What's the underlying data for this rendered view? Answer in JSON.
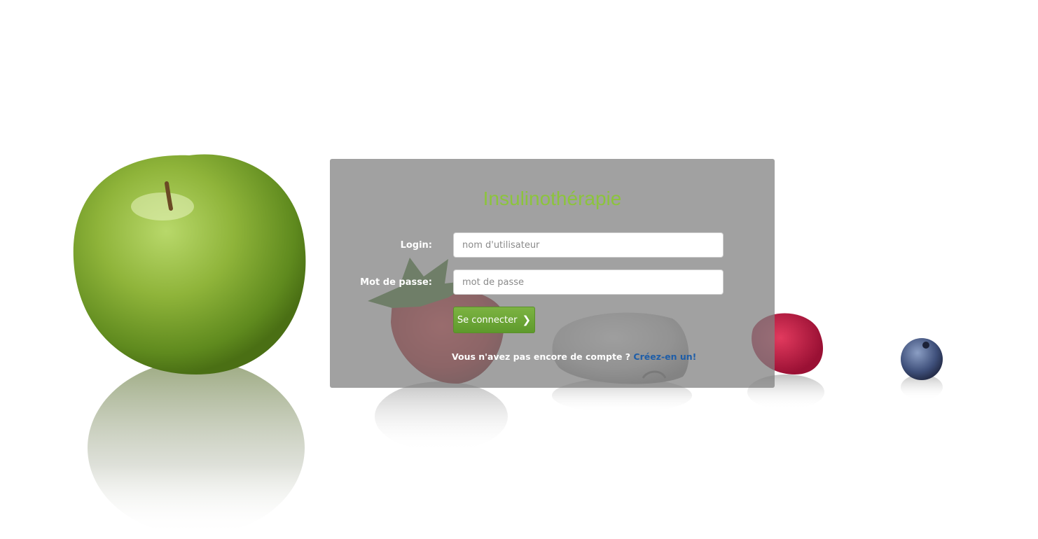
{
  "app": {
    "title": "Insulinothérapie",
    "accent_color": "#8cc43c"
  },
  "form": {
    "login_label": "Login:",
    "login_placeholder": "nom d'utilisateur",
    "login_value": "",
    "password_label": "Mot de passe:",
    "password_placeholder": "mot de passe",
    "password_value": "",
    "submit_label": "Se connecter",
    "submit_icon": "chevron-right-icon"
  },
  "signup": {
    "prompt": "Vous n'avez pas encore de compte ?",
    "link_label": "Créez-en un!"
  },
  "background": {
    "description_icons": [
      "green-apple-image",
      "strawberry-image",
      "insulin-pod-image",
      "raspberry-image",
      "blueberry-image"
    ]
  }
}
